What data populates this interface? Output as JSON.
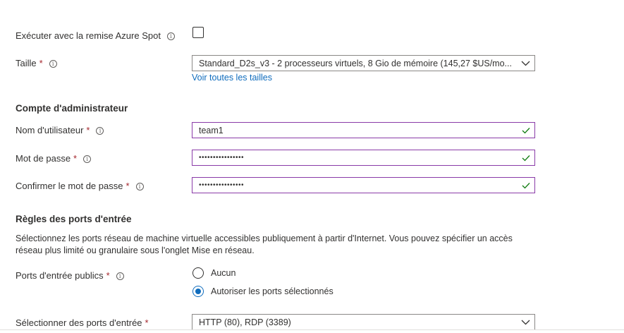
{
  "spot": {
    "label": "Exécuter avec la remise Azure Spot",
    "checked": false
  },
  "size": {
    "label": "Taille",
    "required_mark": "*",
    "value": "Standard_D2s_v3 - 2 processeurs virtuels, 8 Gio de mémoire (145,27 $US/mo...",
    "link": "Voir toutes les tailles"
  },
  "admin": {
    "section_title": "Compte d'administrateur",
    "username": {
      "label": "Nom d'utilisateur",
      "required_mark": "*",
      "value": "team1"
    },
    "password": {
      "label": "Mot de passe",
      "required_mark": "*",
      "value": "••••••••••••••••"
    },
    "confirm": {
      "label": "Confirmer le mot de passe",
      "required_mark": "*",
      "value": "••••••••••••••••"
    }
  },
  "inbound": {
    "section_title": "Règles des ports d'entrée",
    "description": "Sélectionnez les ports réseau de machine virtuelle accessibles publiquement à partir d'Internet. Vous pouvez spécifier un accès réseau plus limité ou granulaire sous l'onglet Mise en réseau.",
    "public_ports": {
      "label": "Ports d'entrée publics",
      "required_mark": "*",
      "options": [
        {
          "label": "Aucun",
          "selected": false
        },
        {
          "label": "Autoriser les ports sélectionnés",
          "selected": true
        }
      ]
    },
    "select_ports": {
      "label": "Sélectionner des ports d'entrée",
      "required_mark": "*",
      "value": "HTTP (80), RDP (3389)"
    }
  },
  "colors": {
    "accent": "#0f6cbd",
    "valid_border": "#8a3ba8",
    "valid_check": "#107c10",
    "required": "#a4262c"
  },
  "icons": {
    "info": "info-icon",
    "check": "checkmark-icon",
    "chevron": "chevron-down-icon"
  }
}
